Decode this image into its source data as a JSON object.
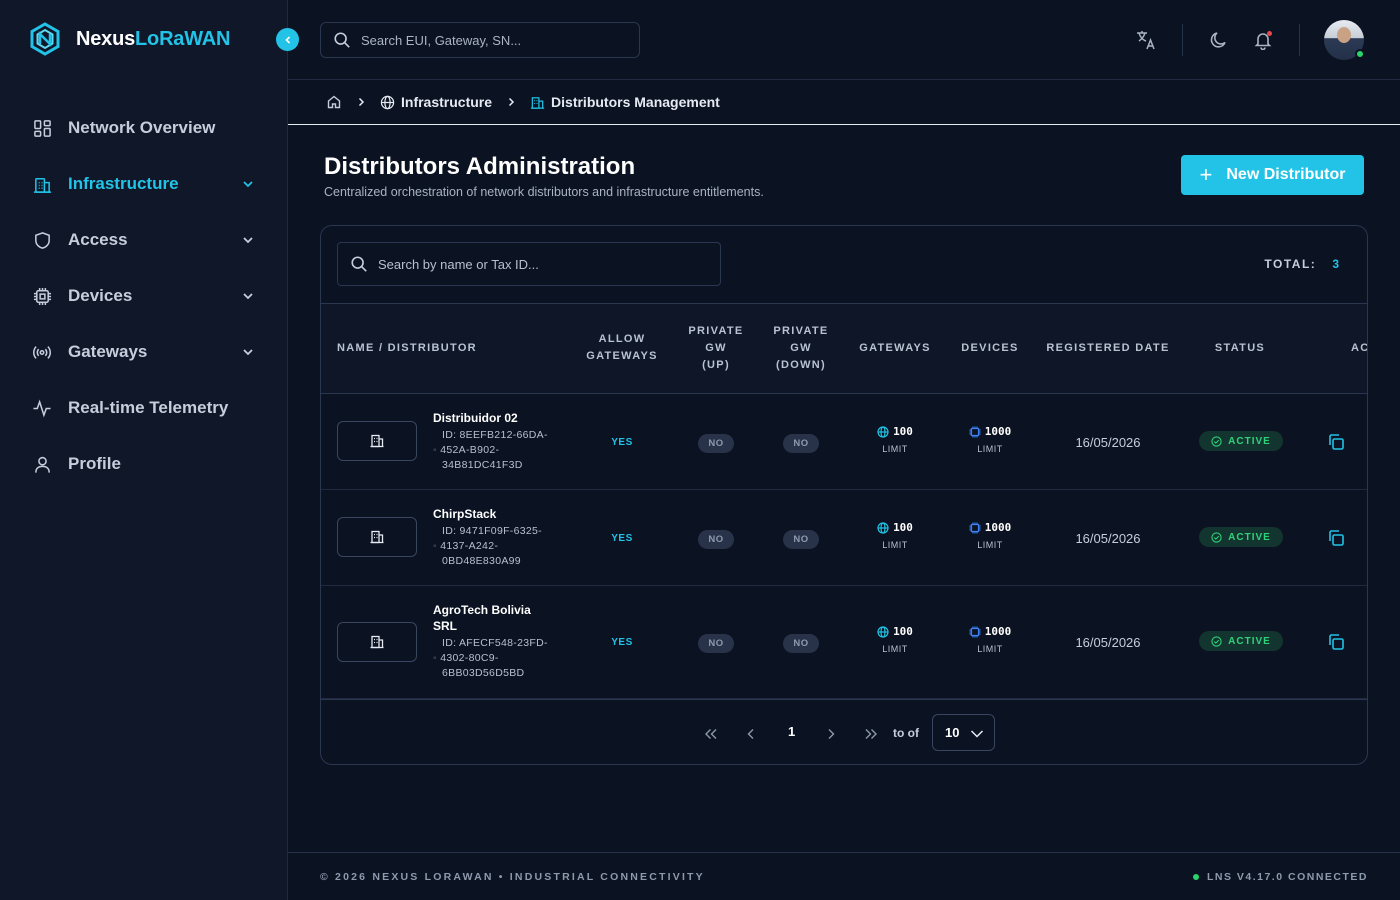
{
  "app": {
    "name_part1": "Nexus",
    "name_part2": "LoRaWAN"
  },
  "colors": {
    "accent": "#22c3e6",
    "background": "#0b1221",
    "sidebar": "#0f1729",
    "success": "#2fd17a"
  },
  "sidebar": {
    "items": [
      {
        "label": "Network Overview",
        "icon": "dashboard-grid-icon"
      },
      {
        "label": "Infrastructure",
        "icon": "building-icon",
        "active": true
      },
      {
        "label": "Access",
        "icon": "shield-icon"
      },
      {
        "label": "Devices",
        "icon": "chip-icon"
      },
      {
        "label": "Gateways",
        "icon": "broadcast-icon"
      },
      {
        "label": "Real-time Telemetry",
        "icon": "pulse-icon"
      },
      {
        "label": "Profile",
        "icon": "user-icon"
      }
    ]
  },
  "topbar": {
    "search_placeholder": "Search EUI, Gateway, SN..."
  },
  "breadcrumb": {
    "items": [
      "Infrastructure",
      "Distributors Management"
    ]
  },
  "page": {
    "title": "Distributors Administration",
    "subtitle": "Centralized orchestration of network distributors and infrastructure entitlements.",
    "new_button": "New Distributor"
  },
  "table": {
    "search_placeholder": "Search by name or Tax ID...",
    "total_label": "TOTAL:",
    "total_value": "3",
    "headers": {
      "name": "NAME / DISTRIBUTOR",
      "allow_l1": "ALLOW",
      "allow_l2": "GATEWAYS",
      "pup_l1": "PRIVATE",
      "pup_l2": "GW",
      "pup_l3": "(UP)",
      "pdown_l1": "PRIVATE",
      "pdown_l2": "GW",
      "pdown_l3": "(DOWN)",
      "gateways": "GATEWAYS",
      "devices": "DEVICES",
      "registered": "REGISTERED DATE",
      "status": "STATUS",
      "actions": "AC"
    },
    "rows": [
      {
        "name": "Distribuidor 02",
        "id_l1": "ID: 8EEFB212-66DA-",
        "id_l2": "452A-B902-",
        "id_l3": "34B81DC41F3D",
        "allow": "YES",
        "private_up": "NO",
        "private_down": "NO",
        "gateways": "100",
        "gateways_label": "LIMIT",
        "devices": "1000",
        "devices_label": "LIMIT",
        "date": "16/05/2026",
        "status": "ACTIVE"
      },
      {
        "name": "ChirpStack",
        "id_l1": "ID: 9471F09F-6325-",
        "id_l2": "4137-A242-",
        "id_l3": "0BD48E830A99",
        "allow": "YES",
        "private_up": "NO",
        "private_down": "NO",
        "gateways": "100",
        "gateways_label": "LIMIT",
        "devices": "1000",
        "devices_label": "LIMIT",
        "date": "16/05/2026",
        "status": "ACTIVE"
      },
      {
        "name_l1": "AgroTech Bolivia",
        "name_l2": "SRL",
        "id_l1": "ID: AFECF548-23FD-",
        "id_l2": "4302-80C9-",
        "id_l3": "6BB03D56D5BD",
        "allow": "YES",
        "private_up": "NO",
        "private_down": "NO",
        "gateways": "100",
        "gateways_label": "LIMIT",
        "devices": "1000",
        "devices_label": "LIMIT",
        "date": "16/05/2026",
        "status": "ACTIVE"
      }
    ]
  },
  "pagination": {
    "page": "1",
    "to_of": "to of",
    "page_size": "10"
  },
  "footer": {
    "left": "© 2026 NEXUS LORAWAN • INDUSTRIAL CONNECTIVITY",
    "right": "LNS V4.17.0 CONNECTED"
  }
}
